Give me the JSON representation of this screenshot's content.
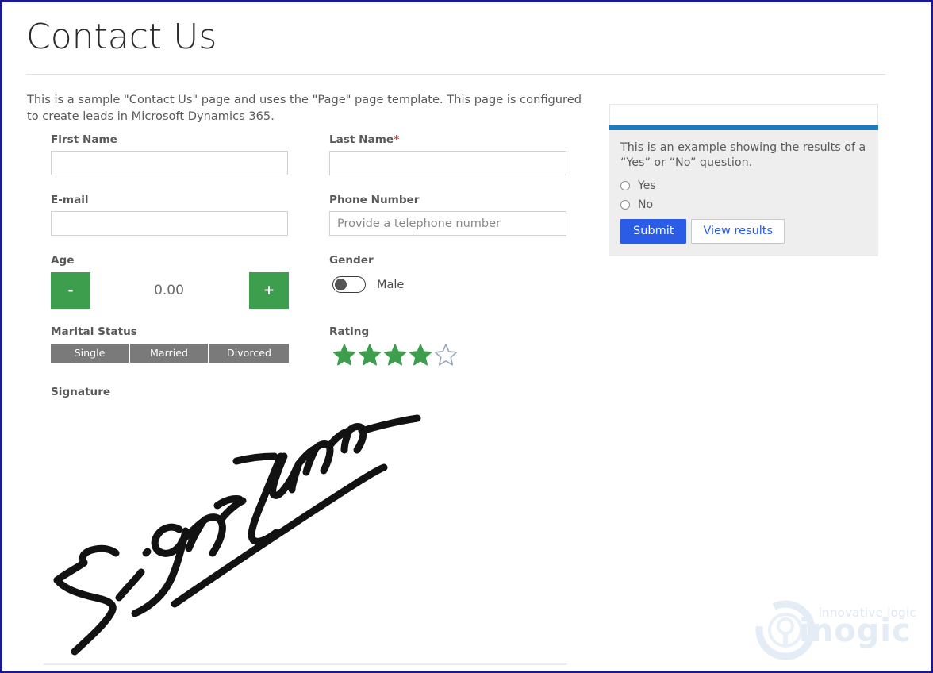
{
  "page": {
    "title": "Contact Us",
    "intro": "This is a sample \"Contact Us\" page and uses the \"Page\" page template. This page is configured to create leads in Microsoft Dynamics 365."
  },
  "form": {
    "first_name": {
      "label": "First Name",
      "value": "",
      "placeholder": ""
    },
    "last_name": {
      "label": "Last Name",
      "required_marker": "*",
      "value": "",
      "placeholder": ""
    },
    "email": {
      "label": "E-mail",
      "value": "",
      "placeholder": ""
    },
    "phone": {
      "label": "Phone Number",
      "value": "",
      "placeholder": "Provide a telephone number"
    },
    "age": {
      "label": "Age",
      "decrement_label": "-",
      "increment_label": "+",
      "value": "0.00"
    },
    "gender": {
      "label": "Gender",
      "toggle_state": "off",
      "value": "Male"
    },
    "marital_status": {
      "label": "Marital Status",
      "options": [
        "Single",
        "Married",
        "Divorced"
      ]
    },
    "rating": {
      "label": "Rating",
      "value": 4,
      "max": 5
    },
    "signature": {
      "label": "Signature",
      "ink_color": "#121212"
    }
  },
  "poll": {
    "header_title": "",
    "accent_color": "#1b7bbd",
    "question": "This is an example showing the results of a “Yes” or “No” question.",
    "options": [
      "Yes",
      "No"
    ],
    "selected": null,
    "submit_label": "Submit",
    "view_results_label": "View results",
    "submit_color": "#2b5ce6"
  },
  "watermark": {
    "tagline": "innovative logic",
    "wordmark": "inogic",
    "color": "#e4ecf6"
  },
  "theme": {
    "green": "#3d9e4d",
    "segment_gray": "#7a7a7a",
    "label_gray": "#58595b",
    "required_red": "#a94442",
    "border_navy": "#1a1a8c"
  }
}
